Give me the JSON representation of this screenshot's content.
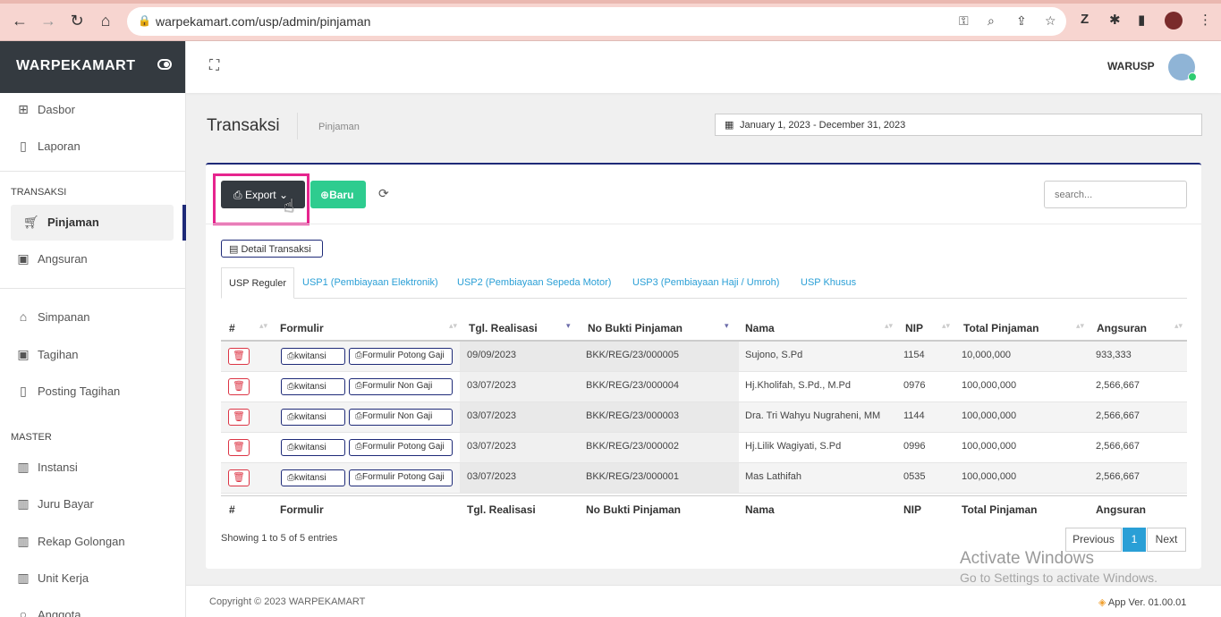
{
  "browser": {
    "url": "warpekamart.com/usp/admin/pinjaman"
  },
  "sidebar": {
    "brand": "WARPEKAMART",
    "items_top": [
      {
        "label": "Dasbor"
      },
      {
        "label": "Laporan"
      }
    ],
    "section_transaksi": "TRANSAKSI",
    "items_transaksi": [
      {
        "label": "Pinjaman"
      },
      {
        "label": "Angsuran"
      }
    ],
    "items_mid": [
      {
        "label": "Simpanan"
      },
      {
        "label": "Tagihan"
      },
      {
        "label": "Posting Tagihan"
      }
    ],
    "section_master": "MASTER",
    "items_master": [
      {
        "label": "Instansi"
      },
      {
        "label": "Juru Bayar"
      },
      {
        "label": "Rekap Golongan"
      },
      {
        "label": "Unit Kerja"
      },
      {
        "label": "Anggota"
      }
    ]
  },
  "header": {
    "user": "WARUSP"
  },
  "page": {
    "title": "Transaksi",
    "breadcrumb": "Pinjaman",
    "date_range": "January 1, 2023 - December 31, 2023"
  },
  "toolbar": {
    "export_label": "Export",
    "new_label": "Baru",
    "search_placeholder": "search..."
  },
  "detail_button": "Detail Transaksi",
  "tabs": [
    {
      "label": "USP Reguler"
    },
    {
      "label": "USP1 (Pembiayaan Elektronik)"
    },
    {
      "label": "USP2 (Pembiayaan Sepeda Motor)"
    },
    {
      "label": "USP3 (Pembiayaan Haji / Umroh)"
    },
    {
      "label": "USP Khusus"
    }
  ],
  "table": {
    "columns": [
      "#",
      "Formulir",
      "Tgl. Realisasi",
      "No Bukti Pinjaman",
      "Nama",
      "NIP",
      "Total Pinjaman",
      "Angsuran"
    ],
    "kwitansi_label": "kwitansi",
    "rows": [
      {
        "form": "Formulir Potong Gaji",
        "date": "09/09/2023",
        "no": "BKK/REG/23/000005",
        "nama": "Sujono, S.Pd",
        "nip": "1154",
        "total": "10,000,000",
        "angsuran": "933,333"
      },
      {
        "form": "Formulir Non Gaji",
        "date": "03/07/2023",
        "no": "BKK/REG/23/000004",
        "nama": "Hj.Kholifah, S.Pd., M.Pd",
        "nip": "0976",
        "total": "100,000,000",
        "angsuran": "2,566,667"
      },
      {
        "form": "Formulir Non Gaji",
        "date": "03/07/2023",
        "no": "BKK/REG/23/000003",
        "nama": "Dra. Tri Wahyu Nugraheni, MM",
        "nip": "1144",
        "total": "100,000,000",
        "angsuran": "2,566,667"
      },
      {
        "form": "Formulir Potong Gaji",
        "date": "03/07/2023",
        "no": "BKK/REG/23/000002",
        "nama": "Hj.Lilik Wagiyati, S.Pd",
        "nip": "0996",
        "total": "100,000,000",
        "angsuran": "2,566,667"
      },
      {
        "form": "Formulir Potong Gaji",
        "date": "03/07/2023",
        "no": "BKK/REG/23/000001",
        "nama": "Mas Lathifah",
        "nip": "0535",
        "total": "100,000,000",
        "angsuran": "2,566,667"
      }
    ]
  },
  "pagination": {
    "info": "Showing 1 to 5 of 5 entries",
    "prev": "Previous",
    "current": "1",
    "next": "Next"
  },
  "watermark": {
    "line1": "Activate Windows",
    "line2": "Go to Settings to activate Windows."
  },
  "footer": {
    "copyright": "Copyright © 2023 WARPEKAMART",
    "version": "App Ver. 01.00.01"
  }
}
